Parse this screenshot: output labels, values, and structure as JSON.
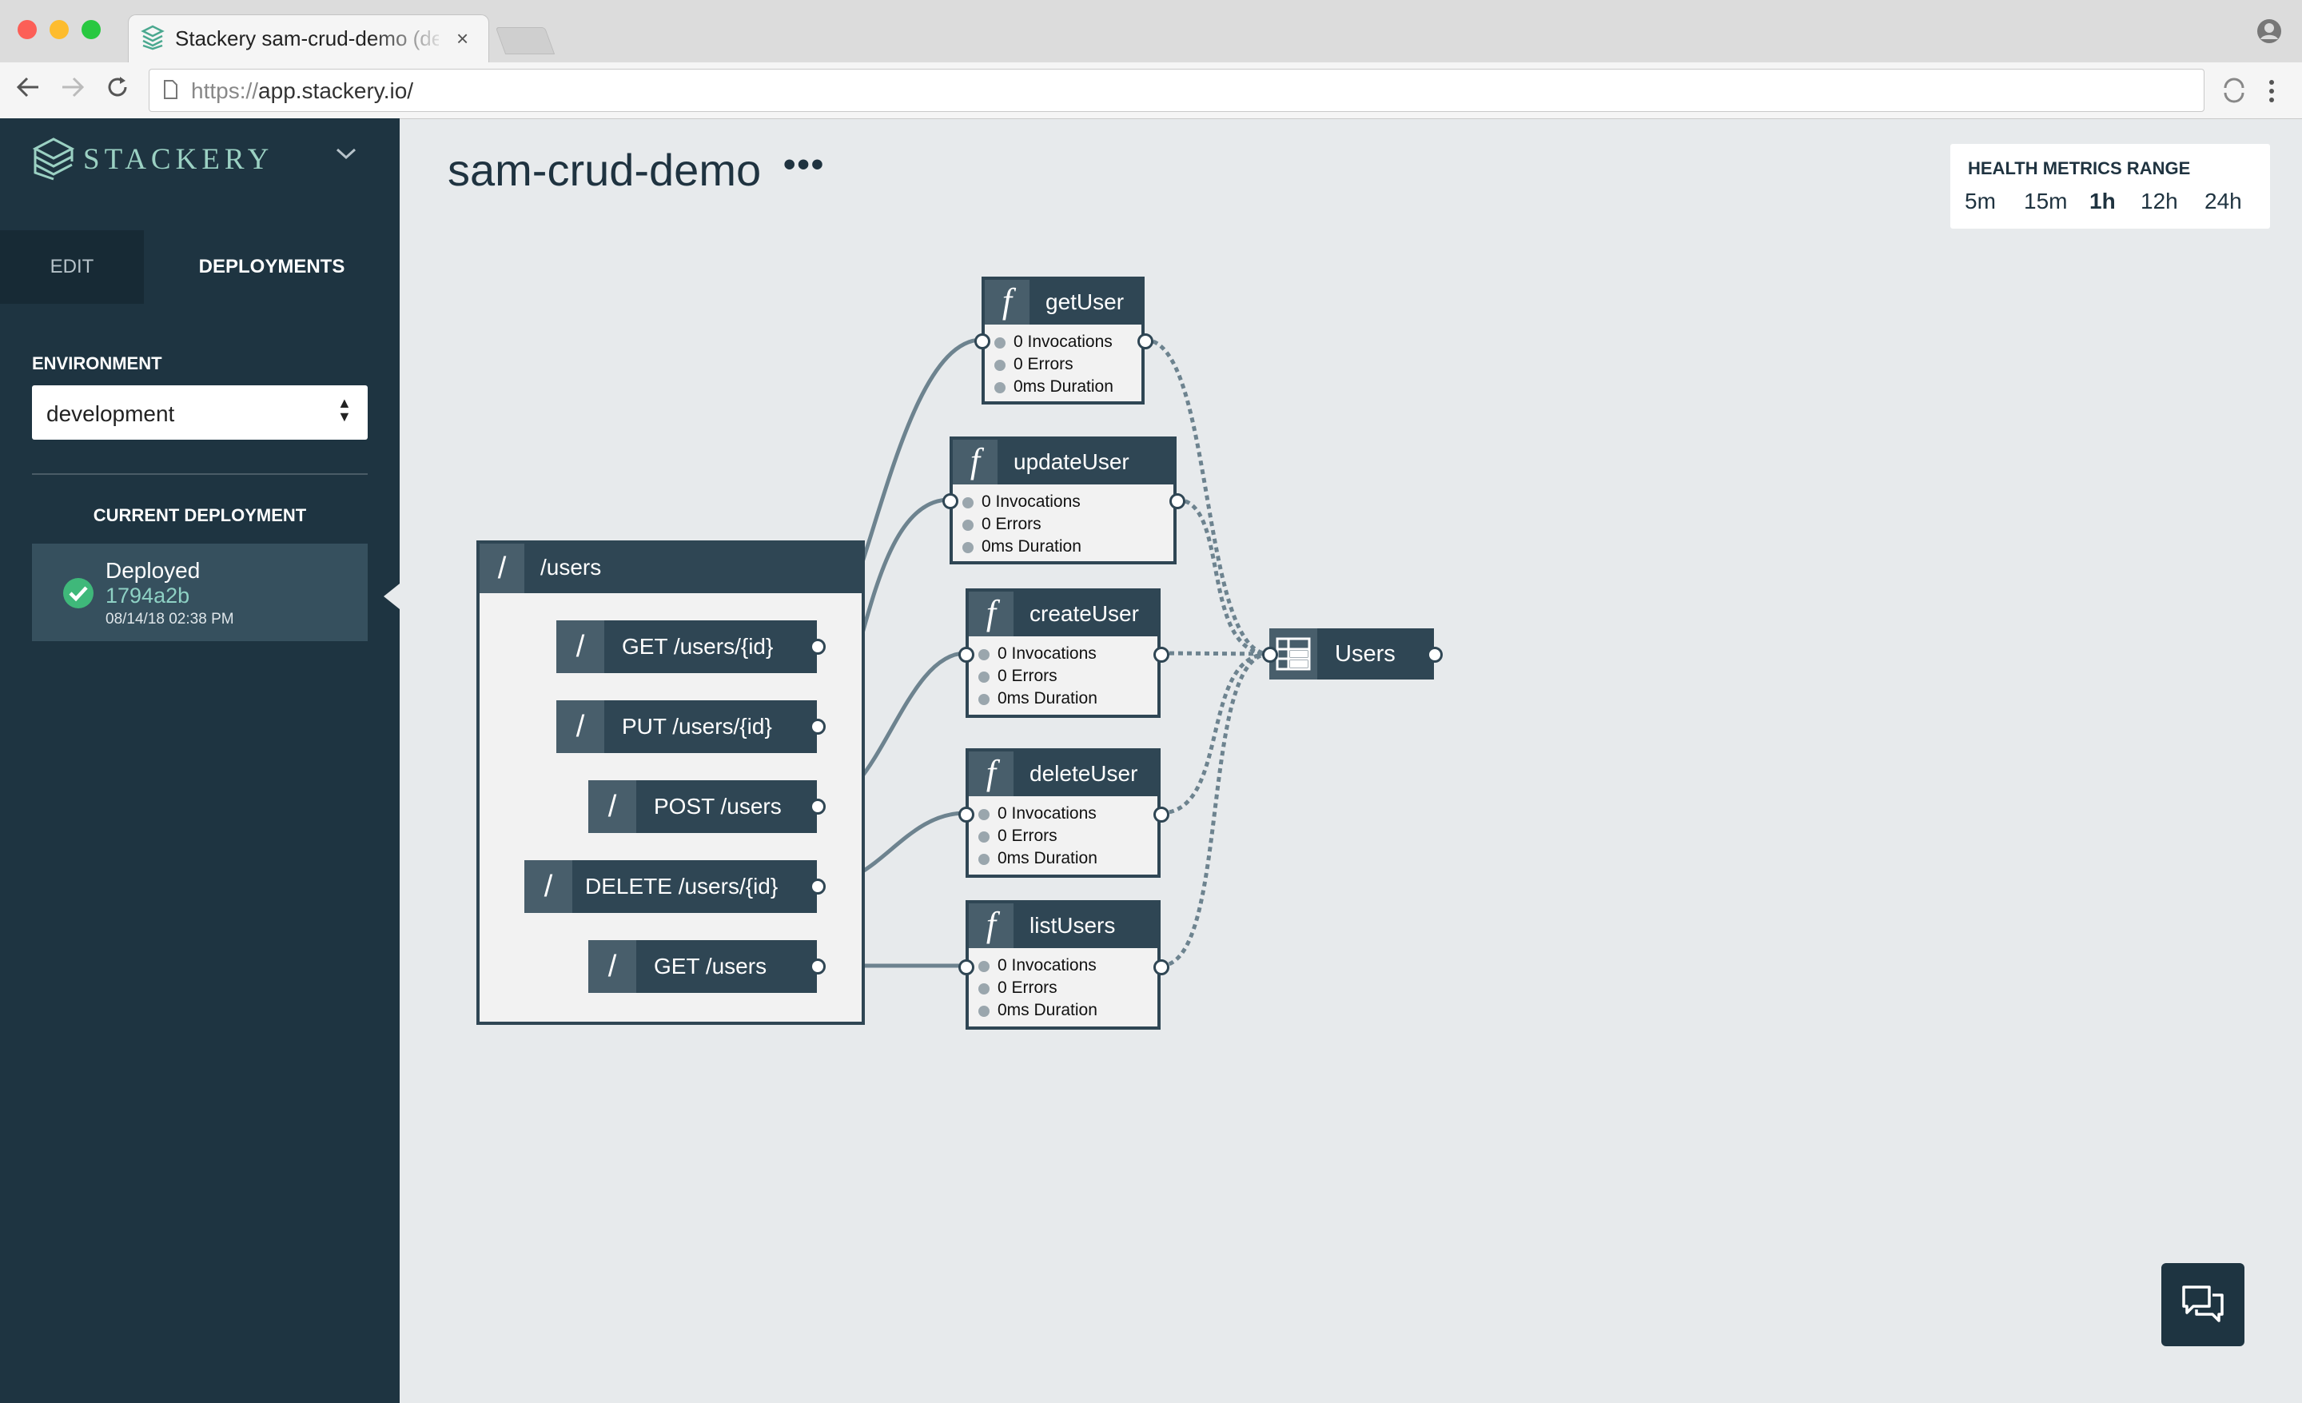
{
  "browser": {
    "tab_title": "Stackery sam-crud-demo (dev",
    "tab_close": "×",
    "url_scheme": "https://",
    "url_host": "app.stackery.io/"
  },
  "sidebar": {
    "brand": "STACKERY",
    "tabs": [
      "EDIT",
      "DEPLOYMENTS"
    ],
    "environment_label": "ENVIRONMENT",
    "environment_value": "development",
    "current_deployment_label": "CURRENT DEPLOYMENT",
    "deployment": {
      "status": "Deployed",
      "hash": "1794a2b",
      "date": "08/14/18 02:38 PM"
    }
  },
  "main": {
    "stack_name": "sam-crud-demo",
    "more_label": "•••",
    "health": {
      "label": "HEALTH METRICS RANGE",
      "options": [
        "5m",
        "15m",
        "1h",
        "12h",
        "24h"
      ],
      "selected": "1h"
    }
  },
  "api": {
    "name": "/users",
    "slash": "/",
    "routes": [
      "GET /users/{id}",
      "PUT /users/{id}",
      "POST /users",
      "DELETE /users/{id}",
      "GET /users"
    ]
  },
  "functions": [
    {
      "name": "getUser",
      "invocations": "0 Invocations",
      "errors": "0 Errors",
      "duration": "0ms Duration"
    },
    {
      "name": "updateUser",
      "invocations": "0 Invocations",
      "errors": "0 Errors",
      "duration": "0ms Duration"
    },
    {
      "name": "createUser",
      "invocations": "0 Invocations",
      "errors": "0 Errors",
      "duration": "0ms Duration"
    },
    {
      "name": "deleteUser",
      "invocations": "0 Invocations",
      "errors": "0 Errors",
      "duration": "0ms Duration"
    },
    {
      "name": "listUsers",
      "invocations": "0 Invocations",
      "errors": "0 Errors",
      "duration": "0ms Duration"
    }
  ],
  "function_glyph": "f",
  "table": {
    "name": "Users"
  },
  "colors": {
    "sidebar": "#1e3441",
    "node": "#2f4654",
    "accent": "#8ed1c4",
    "success": "#3fb87a"
  }
}
